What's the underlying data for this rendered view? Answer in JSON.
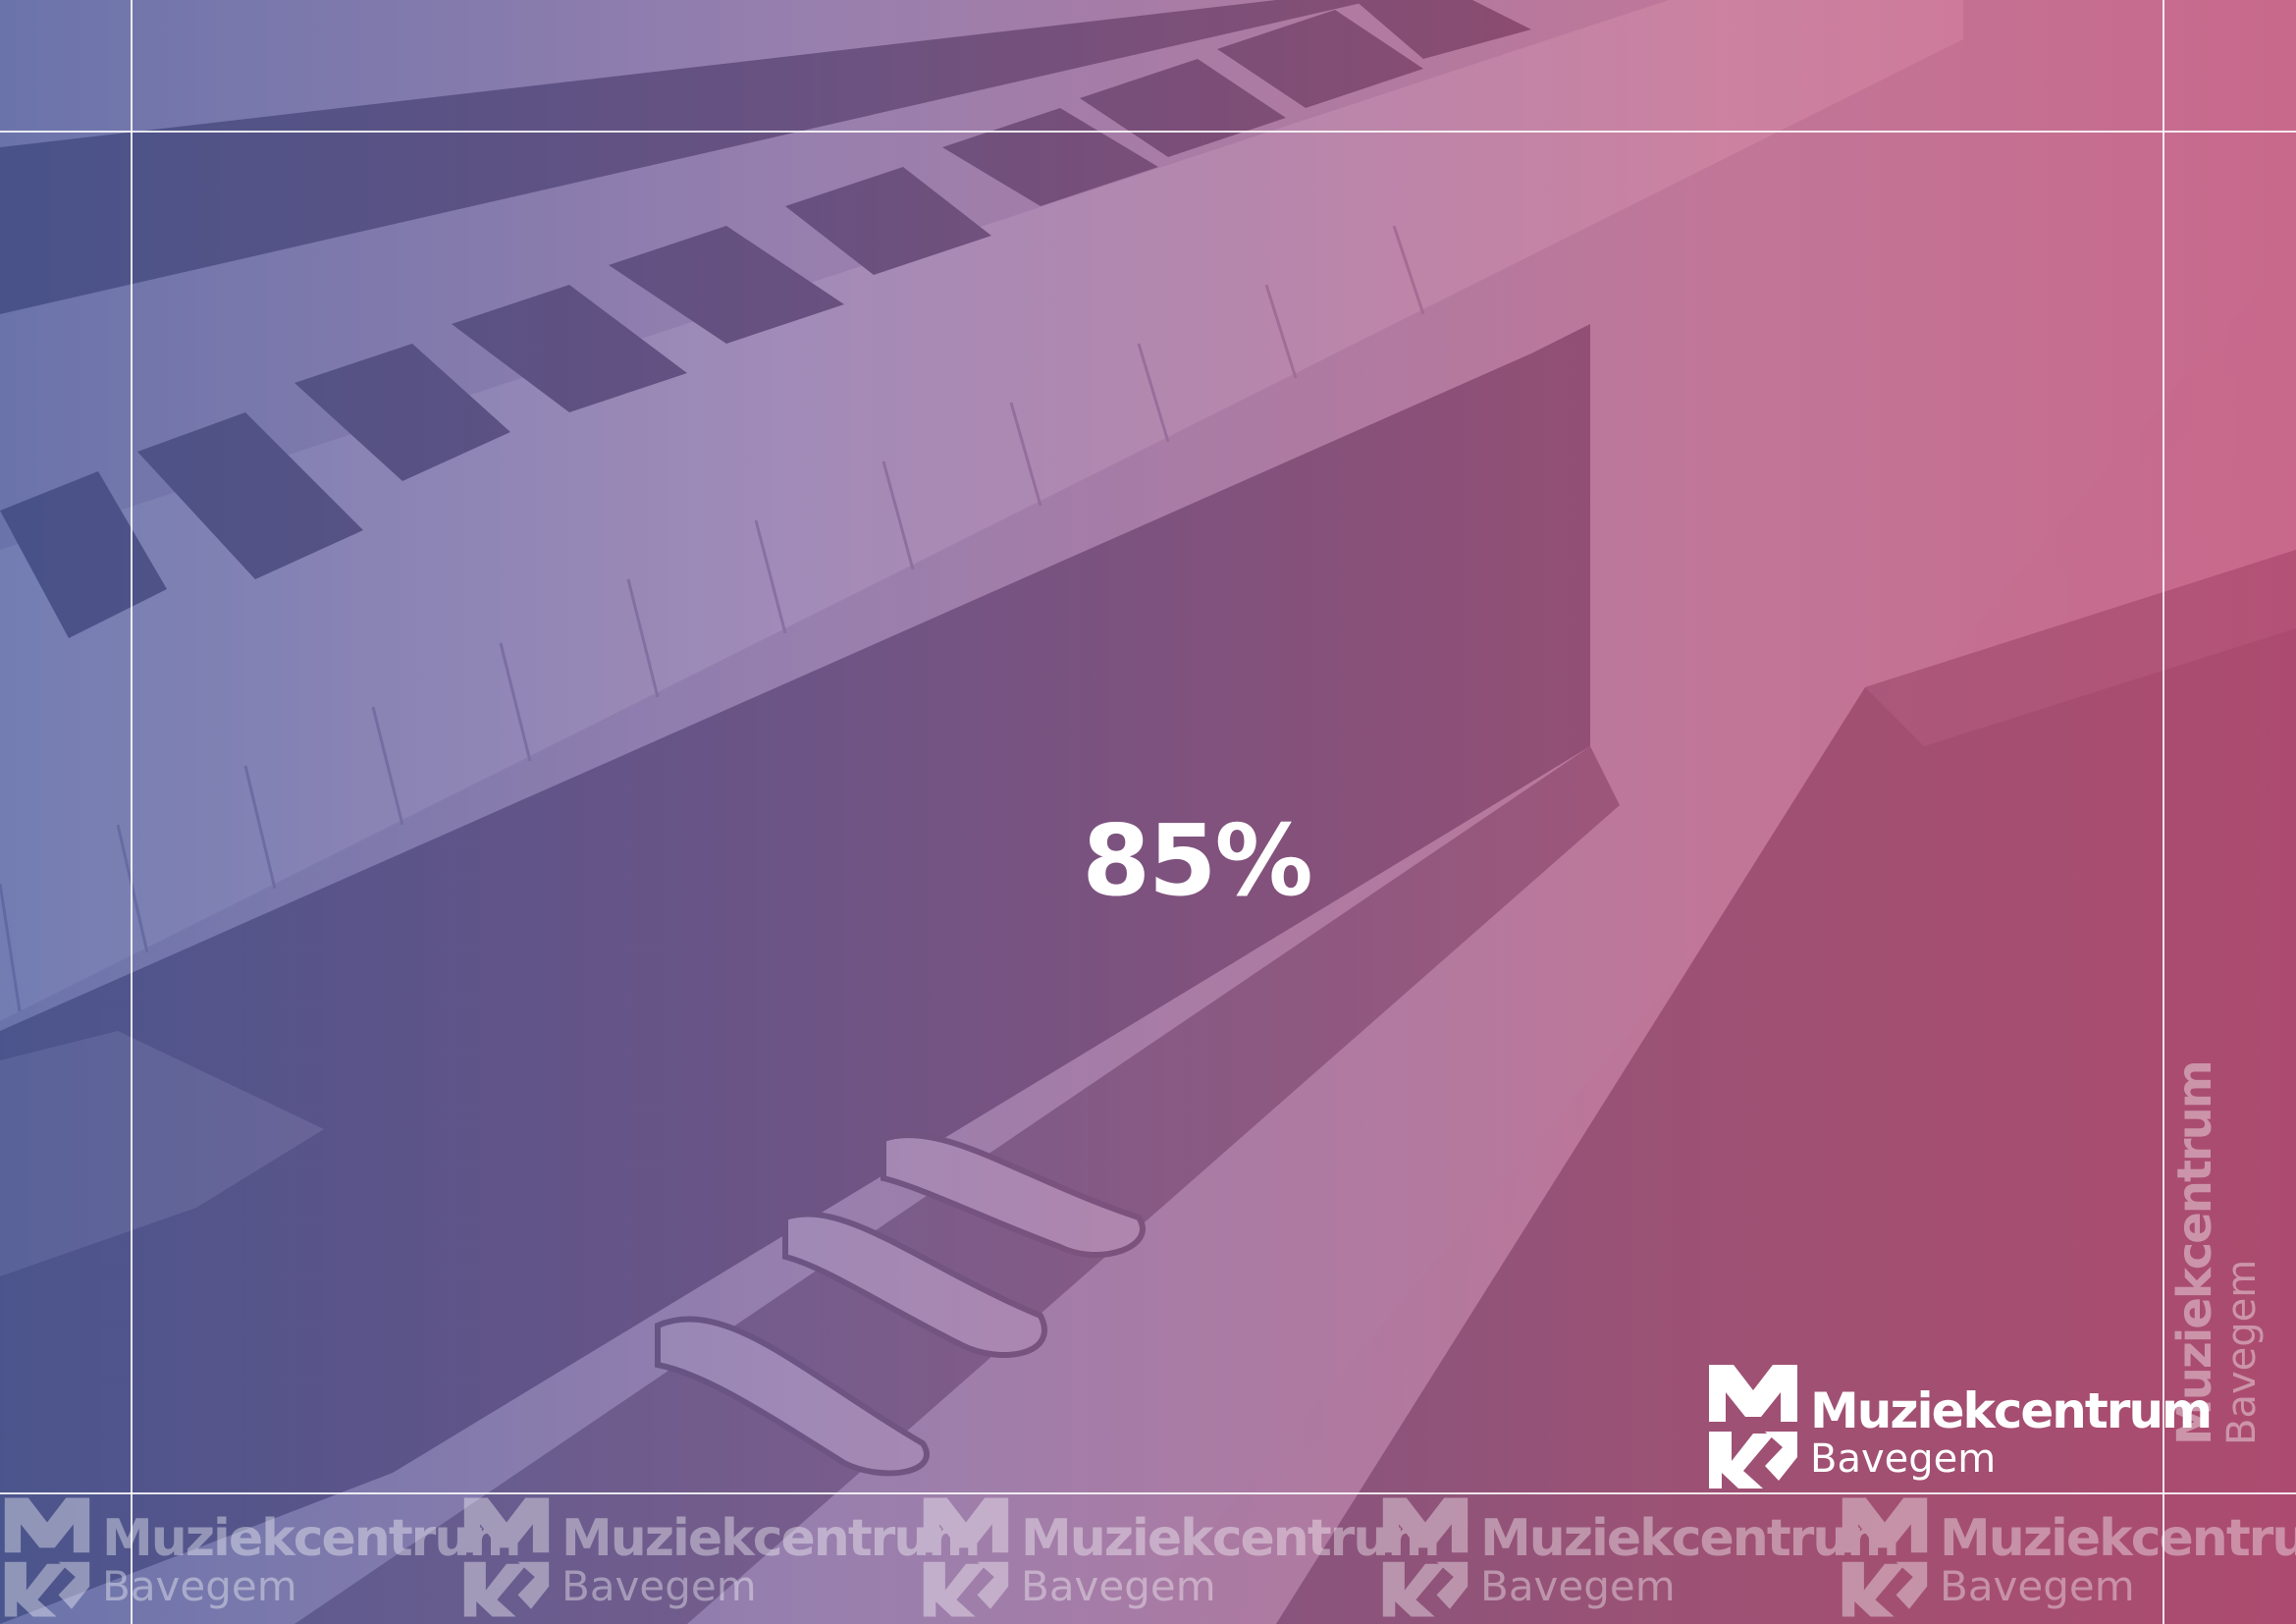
{
  "stat": {
    "value": "85%"
  },
  "brand": {
    "name": "Muziekcentrum",
    "place": "Bavegem",
    "logo_icon": "mk-monogram-icon"
  },
  "colors": {
    "gradient_left": "#5a6aa8",
    "gradient_mid": "#8a6aa0",
    "gradient_right": "#c25a80",
    "text": "#ffffff"
  }
}
